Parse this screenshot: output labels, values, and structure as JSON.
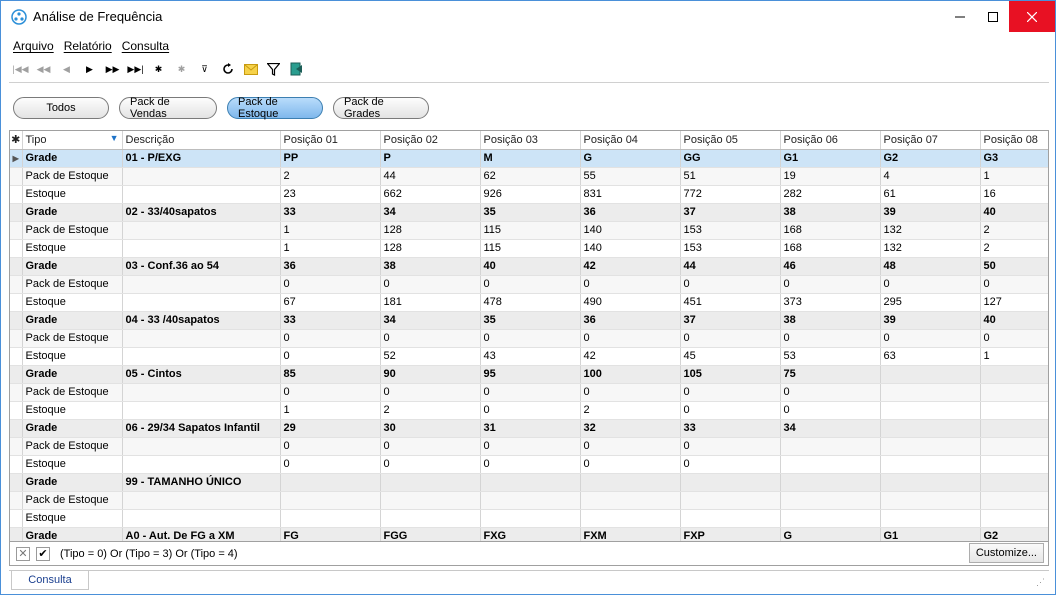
{
  "window": {
    "title": "Análise de Frequência",
    "accent_color": "#4a90d9",
    "close_color": "#e81123"
  },
  "menu": {
    "items": [
      "Arquivo",
      "Relatório",
      "Consulta"
    ]
  },
  "navigator": {
    "buttons": [
      "first-icon",
      "prev-page-icon",
      "prev-icon",
      "next-icon",
      "next-page-icon",
      "last-icon",
      "insert-icon",
      "delete-icon",
      "filter-record-icon",
      "refresh-icon",
      "email-icon",
      "filter-icon",
      "exit-icon"
    ]
  },
  "filters": {
    "buttons": [
      "Todos",
      "Pack de Vendas",
      "Pack de Estoque",
      "Pack de Grades"
    ],
    "selected": "Pack de Estoque",
    "selected_color": "#7fb8ec"
  },
  "grid": {
    "columns": [
      "Tipo",
      "Descrição",
      "Posição 01",
      "Posição 02",
      "Posição 03",
      "Posição 04",
      "Posição 05",
      "Posição 06",
      "Posição 07",
      "Posição 08"
    ],
    "rows": [
      {
        "type": "grade",
        "cells": [
          "Grade",
          "01 - P/EXG",
          "PP",
          "P",
          "M",
          "G",
          "GG",
          "G1",
          "G2",
          "G3"
        ]
      },
      {
        "type": "sub",
        "cells": [
          "Pack de Estoque",
          "",
          "2",
          "44",
          "62",
          "55",
          "51",
          "19",
          "4",
          "1"
        ]
      },
      {
        "type": "sub",
        "cells": [
          "Estoque",
          "",
          "23",
          "662",
          "926",
          "831",
          "772",
          "282",
          "61",
          "16"
        ]
      },
      {
        "type": "grade",
        "cells": [
          "Grade",
          "02 - 33/40sapatos",
          "33",
          "34",
          "35",
          "36",
          "37",
          "38",
          "39",
          "40"
        ]
      },
      {
        "type": "sub",
        "cells": [
          "Pack de Estoque",
          "",
          "1",
          "128",
          "115",
          "140",
          "153",
          "168",
          "132",
          "2"
        ]
      },
      {
        "type": "sub",
        "cells": [
          "Estoque",
          "",
          "1",
          "128",
          "115",
          "140",
          "153",
          "168",
          "132",
          "2"
        ]
      },
      {
        "type": "grade",
        "cells": [
          "Grade",
          "03 - Conf.36 ao 54",
          "36",
          "38",
          "40",
          "42",
          "44",
          "46",
          "48",
          "50"
        ]
      },
      {
        "type": "sub",
        "cells": [
          "Pack de Estoque",
          "",
          "0",
          "0",
          "0",
          "0",
          "0",
          "0",
          "0",
          "0"
        ]
      },
      {
        "type": "sub",
        "cells": [
          "Estoque",
          "",
          "67",
          "181",
          "478",
          "490",
          "451",
          "373",
          "295",
          "127"
        ]
      },
      {
        "type": "grade",
        "cells": [
          "Grade",
          "04 - 33 /40sapatos",
          "33",
          "34",
          "35",
          "36",
          "37",
          "38",
          "39",
          "40"
        ]
      },
      {
        "type": "sub",
        "cells": [
          "Pack de Estoque",
          "",
          "0",
          "0",
          "0",
          "0",
          "0",
          "0",
          "0",
          "0"
        ]
      },
      {
        "type": "sub",
        "cells": [
          "Estoque",
          "",
          "0",
          "52",
          "43",
          "42",
          "45",
          "53",
          "63",
          "1"
        ]
      },
      {
        "type": "grade",
        "cells": [
          "Grade",
          "05 - Cintos",
          "85",
          "90",
          "95",
          "100",
          "105",
          "75",
          "",
          ""
        ]
      },
      {
        "type": "sub",
        "cells": [
          "Pack de Estoque",
          "",
          "0",
          "0",
          "0",
          "0",
          "0",
          "0",
          "",
          ""
        ]
      },
      {
        "type": "sub",
        "cells": [
          "Estoque",
          "",
          "1",
          "2",
          "0",
          "2",
          "0",
          "0",
          "",
          ""
        ]
      },
      {
        "type": "grade",
        "cells": [
          "Grade",
          "06 - 29/34 Sapatos Infantil",
          "29",
          "30",
          "31",
          "32",
          "33",
          "34",
          "",
          ""
        ]
      },
      {
        "type": "sub",
        "cells": [
          "Pack de Estoque",
          "",
          "0",
          "0",
          "0",
          "0",
          "0",
          "",
          "",
          ""
        ]
      },
      {
        "type": "sub",
        "cells": [
          "Estoque",
          "",
          "0",
          "0",
          "0",
          "0",
          "0",
          "",
          "",
          ""
        ]
      },
      {
        "type": "grade",
        "cells": [
          "Grade",
          "99 - TAMANHO ÚNICO",
          "",
          "",
          "",
          "",
          "",
          "",
          "",
          ""
        ]
      },
      {
        "type": "sub",
        "cells": [
          "Pack de Estoque",
          "",
          "",
          "",
          "",
          "",
          "",
          "",
          "",
          ""
        ]
      },
      {
        "type": "sub",
        "cells": [
          "Estoque",
          "",
          "",
          "",
          "",
          "",
          "",
          "",
          "",
          ""
        ]
      },
      {
        "type": "grade",
        "cells": [
          "Grade",
          "A0 - Aut. De FG a XM",
          "FG",
          "FGG",
          "FXG",
          "FXM",
          "FXP",
          "G",
          "G1",
          "G2"
        ]
      }
    ],
    "selected_row": 0
  },
  "filter_bar": {
    "expression": "(Tipo = 0) Or (Tipo = 3) Or (Tipo = 4)",
    "customize_label": "Customize..."
  },
  "tabs": {
    "active": "Consulta"
  }
}
